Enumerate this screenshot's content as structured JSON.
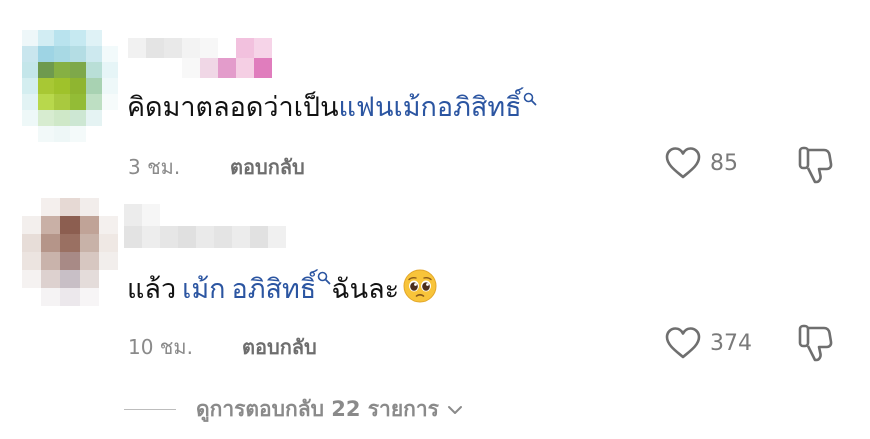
{
  "comments": [
    {
      "text_plain": "คิดมาตลอดว่าเป็น",
      "mention": "แฟนเม้กอภิสิทธิ์",
      "time": "3 ชม.",
      "reply_label": "ตอบกลับ",
      "likes": "85"
    },
    {
      "text_plain": "แล้ว",
      "mention_first": "เม้ก",
      "mention_second": "อภิสิทธิ์",
      "text_after": "ฉันละ",
      "emoji": "pleading-face",
      "time": "10 ชม.",
      "reply_label": "ตอบกลับ",
      "likes": "374"
    }
  ],
  "view_replies": {
    "label": "ดูการตอบกลับ 22 รายการ"
  },
  "colors": {
    "mention": "#2b55a1",
    "meta": "#8a8a8a",
    "icon": "#6f6f6f"
  }
}
